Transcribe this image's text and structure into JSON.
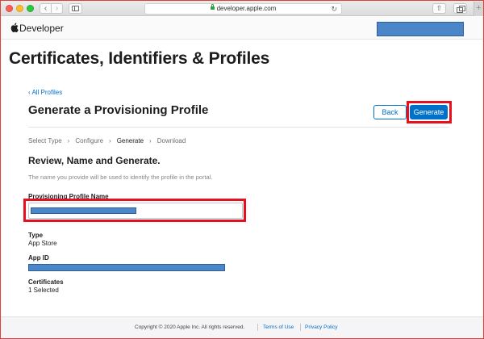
{
  "browser": {
    "url": "developer.apple.com",
    "back_glyph": "‹",
    "forward_glyph": "›",
    "reload_glyph": "↻",
    "share_glyph": "⇧",
    "new_tab_glyph": "+"
  },
  "site": {
    "brand": "Developer"
  },
  "page": {
    "title": "Certificates, Identifiers & Profiles",
    "back_link": "‹ All Profiles",
    "section_title": "Generate a Provisioning Profile"
  },
  "actions": {
    "back_label": "Back",
    "generate_label": "Generate"
  },
  "steps": [
    "Select Type",
    "Configure",
    "Generate",
    "Download"
  ],
  "steps_active_index": 2,
  "step_separator": "›",
  "review": {
    "title": "Review, Name and Generate.",
    "description": "The name you provide will be used to identify the profile in the portal."
  },
  "fields": {
    "profile_name_label": "Provisioning Profile Name",
    "type_label": "Type",
    "type_value": "App Store",
    "app_id_label": "App ID",
    "certificates_label": "Certificates",
    "certificates_value": "1 Selected"
  },
  "footer": {
    "copyright": "Copyright © 2020 Apple Inc. All rights reserved.",
    "terms": "Terms of Use",
    "privacy": "Privacy Policy"
  },
  "colors": {
    "accent": "#0070c9",
    "highlight": "#e8101e",
    "redaction": "#4a86c8"
  }
}
